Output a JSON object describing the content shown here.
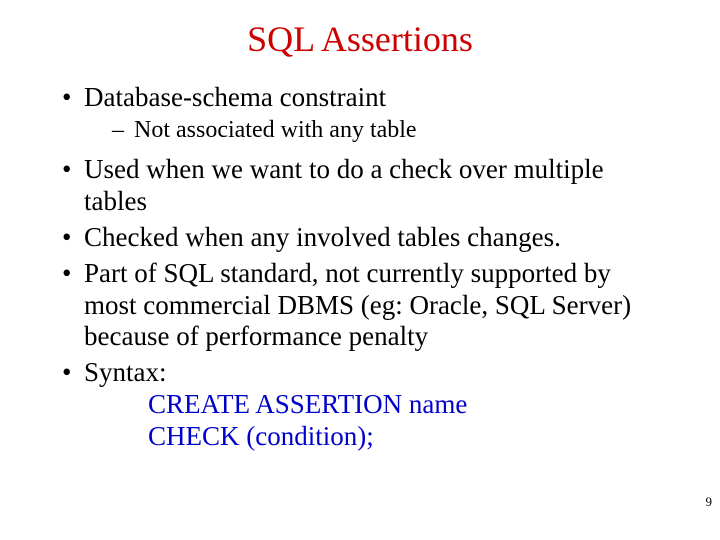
{
  "title": "SQL Assertions",
  "bullets": {
    "b1": "Database-schema constraint",
    "b1_sub": "Not associated with any table",
    "b2": "Used when we want to do a check over multiple tables",
    "b3": "Checked when any involved tables changes.",
    "b4": "Part of SQL standard, not currently supported by most commercial DBMS (eg: Oracle, SQL Server) because of performance penalty",
    "b5": "Syntax:"
  },
  "syntax": {
    "line1": "CREATE ASSERTION   name",
    "line2": "CHECK (condition);"
  },
  "page_number": "9"
}
